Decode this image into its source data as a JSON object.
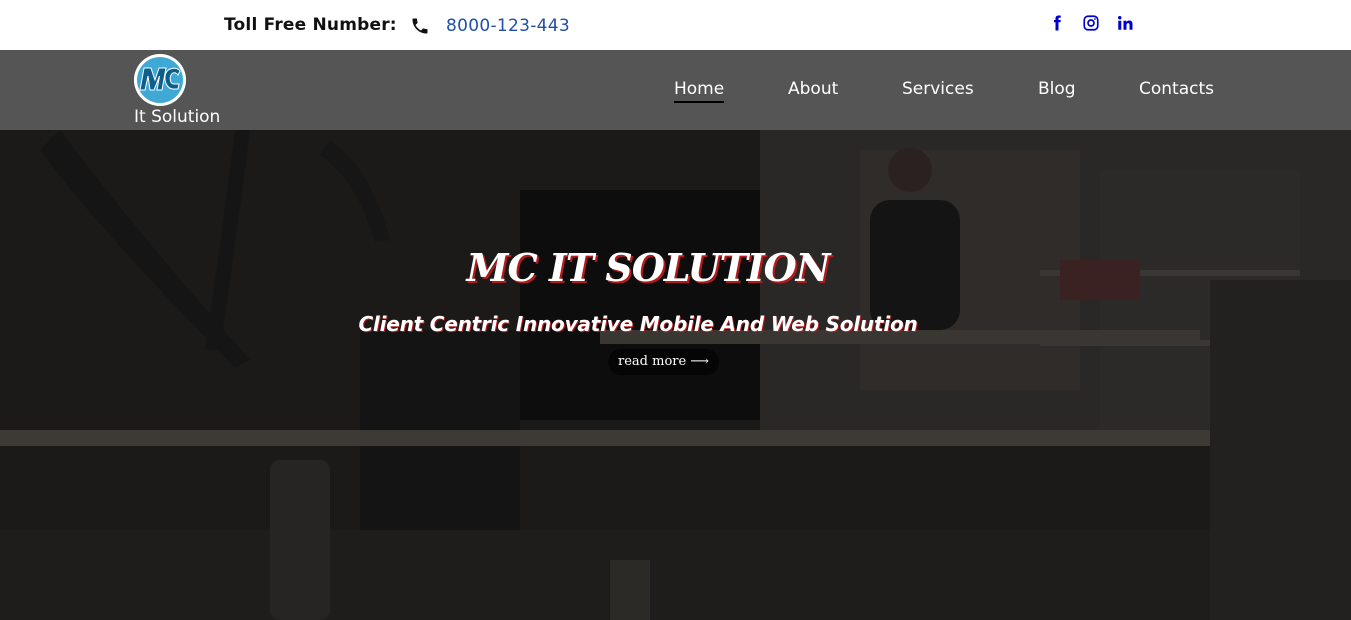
{
  "topbar": {
    "toll_label": "Toll Free Number:",
    "phone_icon": "phone-icon",
    "phone_number": "8000-123-443",
    "social": [
      "facebook-icon",
      "instagram-icon",
      "linkedin-icon"
    ],
    "social_color": "#0000cc"
  },
  "navbar": {
    "logo_text": "It Solution",
    "logo_mark": "MC",
    "items": [
      {
        "label": "Home",
        "active": true
      },
      {
        "label": "About",
        "active": false
      },
      {
        "label": "Services",
        "active": false
      },
      {
        "label": "Blog",
        "active": false
      },
      {
        "label": "Contacts",
        "active": false
      }
    ],
    "background": "#555555"
  },
  "hero": {
    "title": "MC IT SOLUTION",
    "subtitle": "Client Centric Innovative Mobile And Web Solution",
    "button_label": "read more ⟶",
    "accent": "#b31b1b"
  }
}
